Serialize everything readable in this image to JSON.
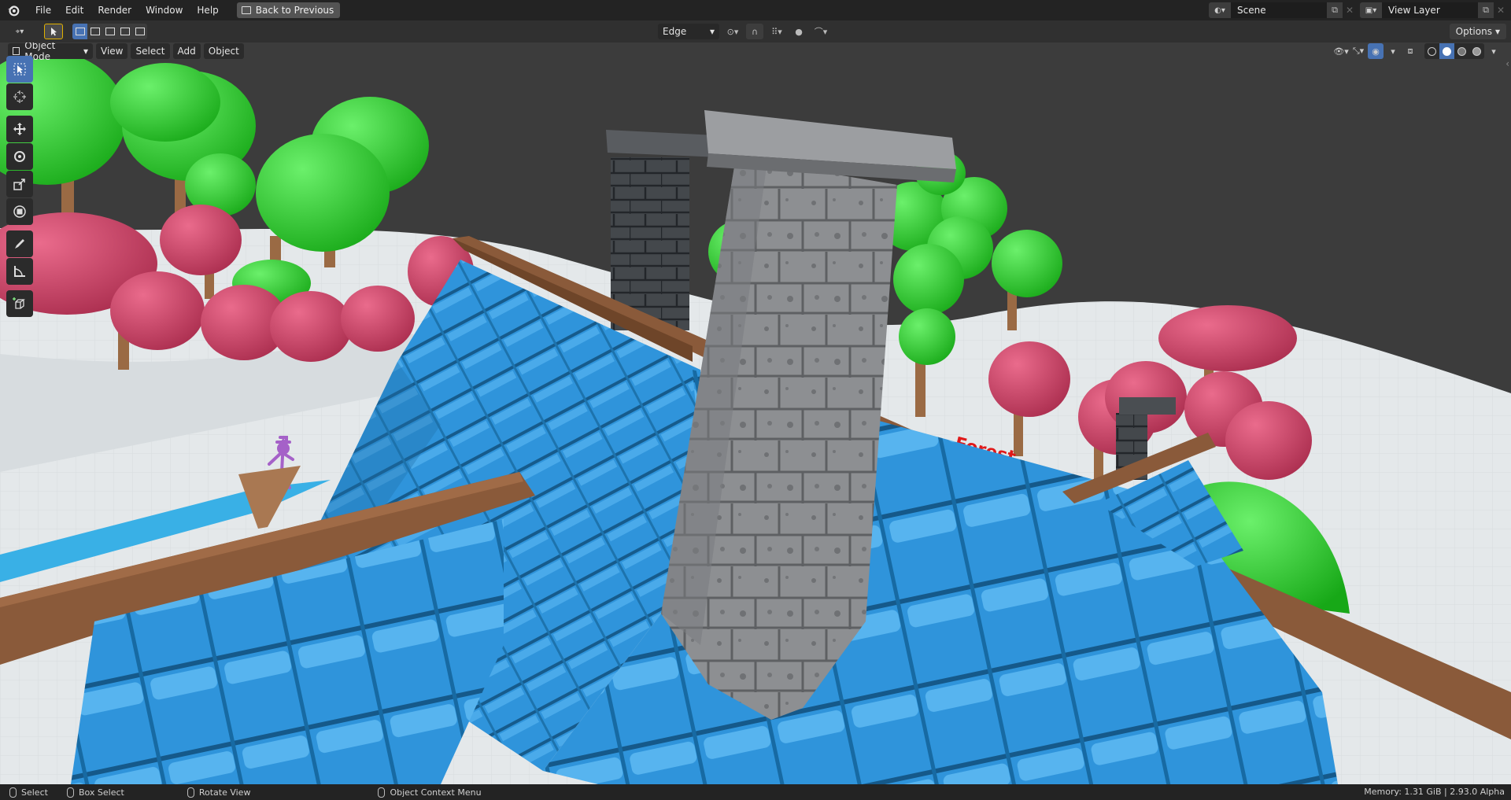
{
  "topbar": {
    "menus": [
      "File",
      "Edit",
      "Render",
      "Window",
      "Help"
    ],
    "back_button": "Back to Previous",
    "scene_name": "Scene",
    "view_layer_name": "View Layer"
  },
  "tool_header": {
    "snap_target": "Edge",
    "options_label": "Options"
  },
  "viewport_header": {
    "mode": "Object Mode",
    "menus": [
      "View",
      "Select",
      "Add",
      "Object"
    ]
  },
  "scene": {
    "signage_text": "Forest",
    "colors": {
      "roof_tiles": "#2f94db",
      "chimney": "#8d8f92",
      "dark_chimney": "#44484c",
      "beam": "#8a5a3a",
      "tree_green": "#2ecc2e",
      "tree_pink": "#d04568",
      "ground": "#e4e8ea",
      "selection_accent": "#4772b3"
    }
  },
  "statusbar": {
    "select": "Select",
    "box_select": "Box Select",
    "rotate_view": "Rotate View",
    "context_menu": "Object Context Menu",
    "memory": "Memory: 1.31 GiB | 2.93.0 Alpha"
  }
}
